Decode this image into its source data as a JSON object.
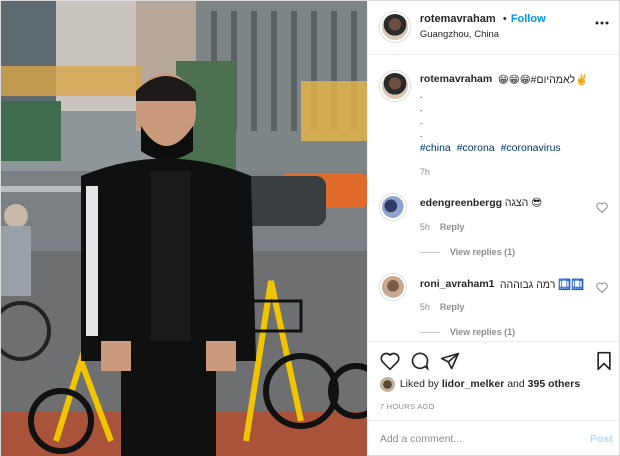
{
  "header": {
    "username": "rotemavraham",
    "dot": "•",
    "follow_label": "Follow",
    "location": "Guangzhou, China",
    "more_icon": "more-horizontal-icon"
  },
  "caption": {
    "username": "rotemavraham",
    "text": "😁😁😁#לאמהיום✌️",
    "dots": [
      ".",
      ".",
      ".",
      "."
    ],
    "hashtags": [
      "#china",
      "#corona",
      "#coronavirus"
    ],
    "time": "7h"
  },
  "comments": [
    {
      "username": "edengreenbergg",
      "text": "הצגה 😎",
      "time": "5h",
      "reply_label": "Reply",
      "view_replies": "View replies (1)"
    },
    {
      "username": "roni_avraham1",
      "text": "רמה גבוההה 🛄🛄",
      "time": "5h",
      "reply_label": "Reply",
      "view_replies": "View replies (1)"
    }
  ],
  "actions": {
    "icons": [
      "heart-icon",
      "comment-icon",
      "share-icon",
      "bookmark-icon"
    ],
    "liked_prefix": "Liked by ",
    "liked_user": "lidor_melker",
    "liked_middle": " and ",
    "liked_count": "395 others",
    "post_time": "7 HOURS AGO"
  },
  "comment_box": {
    "placeholder": "Add a comment...",
    "post_label": "Post"
  },
  "colors": {
    "accent": "#0095f6",
    "hashtag": "#00376b",
    "muted": "#8e8e8e",
    "post_disabled": "#b2dffc"
  }
}
